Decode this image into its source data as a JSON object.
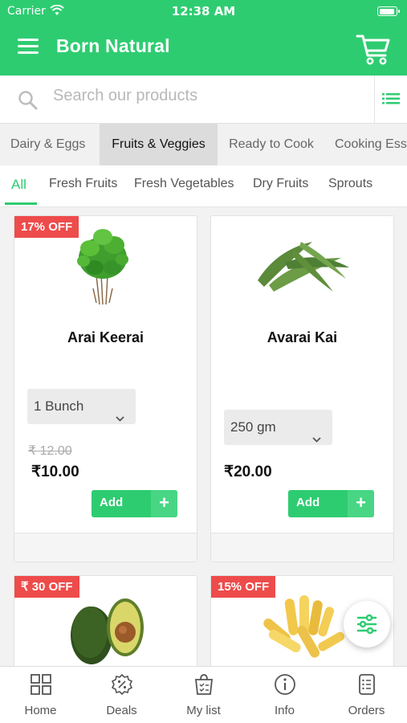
{
  "status_bar": {
    "carrier": "Carrier",
    "time": "12:38 AM"
  },
  "header": {
    "title": "Born Natural",
    "bg_color": "#2ecc71"
  },
  "search": {
    "placeholder": "Search our products"
  },
  "categories": {
    "items": [
      "Dairy & Eggs",
      "Fruits & Veggies",
      "Ready to Cook",
      "Cooking Ess"
    ],
    "selected": "Fruits & Veggies"
  },
  "subcategories": {
    "items": [
      "All",
      "Fresh Fruits",
      "Fresh Vegetables",
      "Dry Fruits",
      "Sprouts"
    ],
    "selected": "All"
  },
  "products": [
    {
      "badge": "17% OFF",
      "name": "Arai Keerai",
      "unit": "1 Bunch",
      "mrp": "₹ 12.00",
      "price": "₹10.00",
      "add_label": "Add",
      "image": "spinach-bunch"
    },
    {
      "badge": "",
      "name": "Avarai Kai",
      "unit": "250 gm",
      "mrp": "",
      "price": "₹20.00",
      "add_label": "Add",
      "image": "broad-beans"
    },
    {
      "badge": "₹ 30 OFF",
      "name": "",
      "image": "avocado"
    },
    {
      "badge": "15% OFF",
      "name": "",
      "image": "baby-corn"
    }
  ],
  "bottom_nav": [
    {
      "label": "Home",
      "icon": "grid-icon"
    },
    {
      "label": "Deals",
      "icon": "discount-badge-icon"
    },
    {
      "label": "My list",
      "icon": "shopping-list-icon"
    },
    {
      "label": "Info",
      "icon": "info-icon"
    },
    {
      "label": "Orders",
      "icon": "orders-icon"
    }
  ],
  "colors": {
    "accent": "#2ecc71",
    "discount": "#ee4b4b"
  }
}
